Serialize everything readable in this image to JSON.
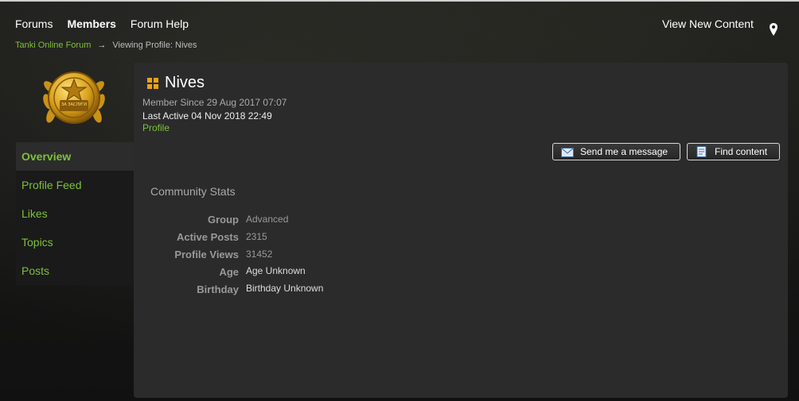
{
  "topnav": {
    "items": [
      {
        "label": "Forums"
      },
      {
        "label": "Members"
      },
      {
        "label": "Forum Help"
      }
    ],
    "view_new": "View New Content",
    "location_icon": "map-pin-icon"
  },
  "breadcrumb": {
    "home": "Tanki Online Forum",
    "separator": "→",
    "current": "Viewing Profile: Nives"
  },
  "avatar": {
    "icon": "gold-laurel-badge-icon",
    "badge_text": "ЗА ЗАСЛУГИ"
  },
  "sidebar": {
    "items": [
      {
        "label": "Overview"
      },
      {
        "label": "Profile Feed"
      },
      {
        "label": "Likes"
      },
      {
        "label": "Topics"
      },
      {
        "label": "Posts"
      }
    ]
  },
  "profile": {
    "name": "Nives",
    "member_since": "Member Since 29 Aug 2017 07:07",
    "last_active": "Last Active 04 Nov 2018 22:49",
    "profile_link": "Profile"
  },
  "actions": {
    "send_message": "Send me a message",
    "find_content": "Find content"
  },
  "stats": {
    "title": "Community Stats",
    "rows": [
      {
        "label": "Group",
        "value": "Advanced"
      },
      {
        "label": "Active Posts",
        "value": "2315"
      },
      {
        "label": "Profile Views",
        "value": "31452"
      },
      {
        "label": "Age",
        "value": "Age Unknown"
      },
      {
        "label": "Birthday",
        "value": "Birthday Unknown"
      }
    ]
  },
  "colors": {
    "accent": "#7cc13a",
    "panel": "#2b2b2b"
  }
}
